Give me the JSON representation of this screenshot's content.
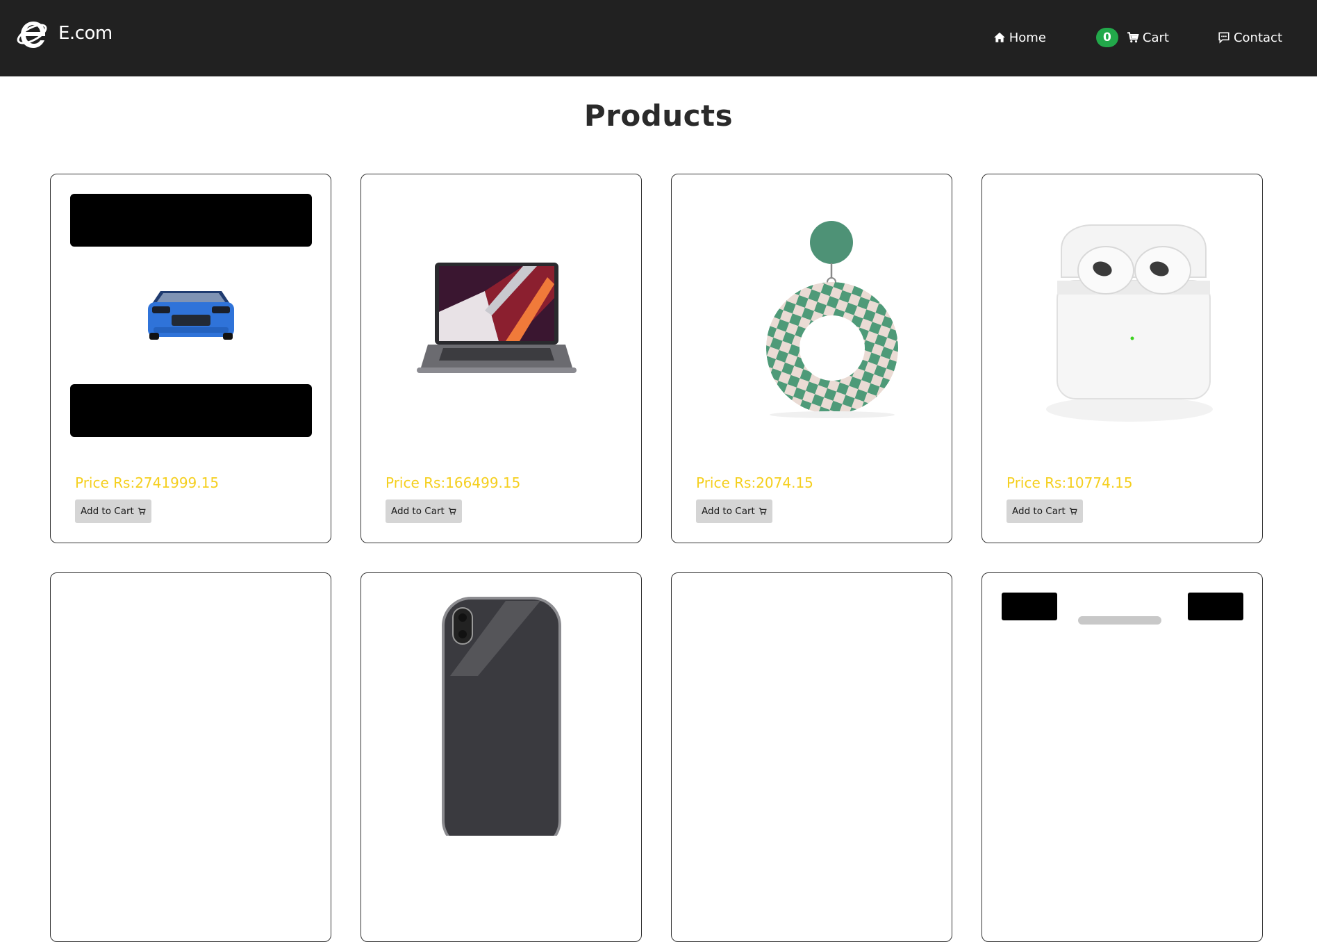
{
  "brand": {
    "name": "E.com",
    "logo_icon": "internet-explorer-e-logo"
  },
  "nav": {
    "home_label": "Home",
    "cart_label": "Cart",
    "cart_count": "0",
    "contact_label": "Contact"
  },
  "page": {
    "title": "Products"
  },
  "products": [
    {
      "price": "Price Rs:2741999.15",
      "button": "Add to Cart",
      "image": "blue-car"
    },
    {
      "price": "Price Rs:166499.15",
      "button": "Add to Cart",
      "image": "laptop"
    },
    {
      "price": "Price Rs:2074.15",
      "button": "Add to Cart",
      "image": "green-checkered-earring"
    },
    {
      "price": "Price Rs:10774.15",
      "button": "Add to Cart",
      "image": "wireless-earbuds-case"
    }
  ],
  "colors": {
    "navbar": "#212121",
    "price": "#f5cf1e",
    "badge": "#22a84a",
    "button_bg": "#d5d5d5"
  }
}
